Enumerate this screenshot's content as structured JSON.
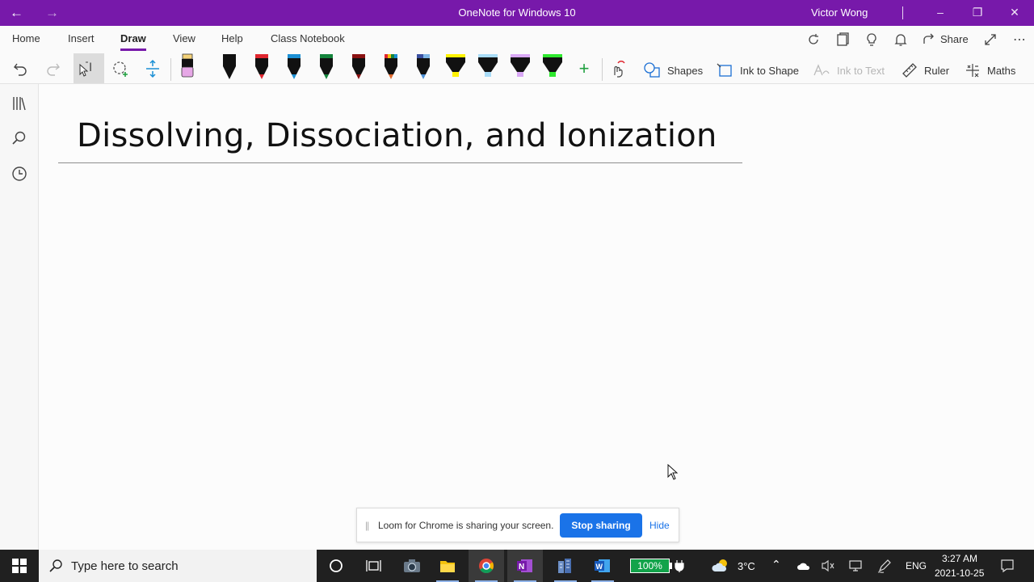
{
  "window": {
    "title": "OneNote for Windows 10",
    "user": "Victor Wong"
  },
  "ribbon": {
    "tabs": [
      {
        "label": "Home"
      },
      {
        "label": "Insert"
      },
      {
        "label": "Draw"
      },
      {
        "label": "View"
      },
      {
        "label": "Help"
      },
      {
        "label": "Class Notebook"
      }
    ],
    "active_tab": "Draw",
    "share_label": "Share"
  },
  "draw_toolbar": {
    "shapes_label": "Shapes",
    "ink_to_shape_label": "Ink to Shape",
    "ink_to_text_label": "Ink to Text",
    "ruler_label": "Ruler",
    "maths_label": "Maths",
    "pens": [
      {
        "type": "pen",
        "color": "#111111"
      },
      {
        "type": "pen",
        "color": "#e0262f"
      },
      {
        "type": "pen",
        "color": "#1b8fd4"
      },
      {
        "type": "pen",
        "color": "#14843c"
      },
      {
        "type": "pen",
        "color": "#8a1212"
      },
      {
        "type": "pen",
        "color": "galaxy-multicolor"
      },
      {
        "type": "pen",
        "color": "galaxy-blue"
      },
      {
        "type": "highlighter",
        "color": "#fff200"
      },
      {
        "type": "highlighter",
        "color": "#a9dcf7"
      },
      {
        "type": "highlighter",
        "color": "#d9a8f5"
      },
      {
        "type": "highlighter",
        "color": "#2ee82e"
      }
    ]
  },
  "page": {
    "title": "Dissolving, Dissociation, and Ionization"
  },
  "loom_banner": {
    "message": "Loom for Chrome is sharing your screen.",
    "stop_label": "Stop sharing",
    "hide_label": "Hide"
  },
  "taskbar": {
    "search_placeholder": "Type here to search",
    "battery": "100%",
    "weather": "3°C",
    "language": "ENG",
    "time": "3:27 AM",
    "date": "2021-10-25"
  },
  "colors": {
    "accent": "#7719aa",
    "loom_button": "#1a73e8",
    "battery_green": "#12a34a"
  }
}
